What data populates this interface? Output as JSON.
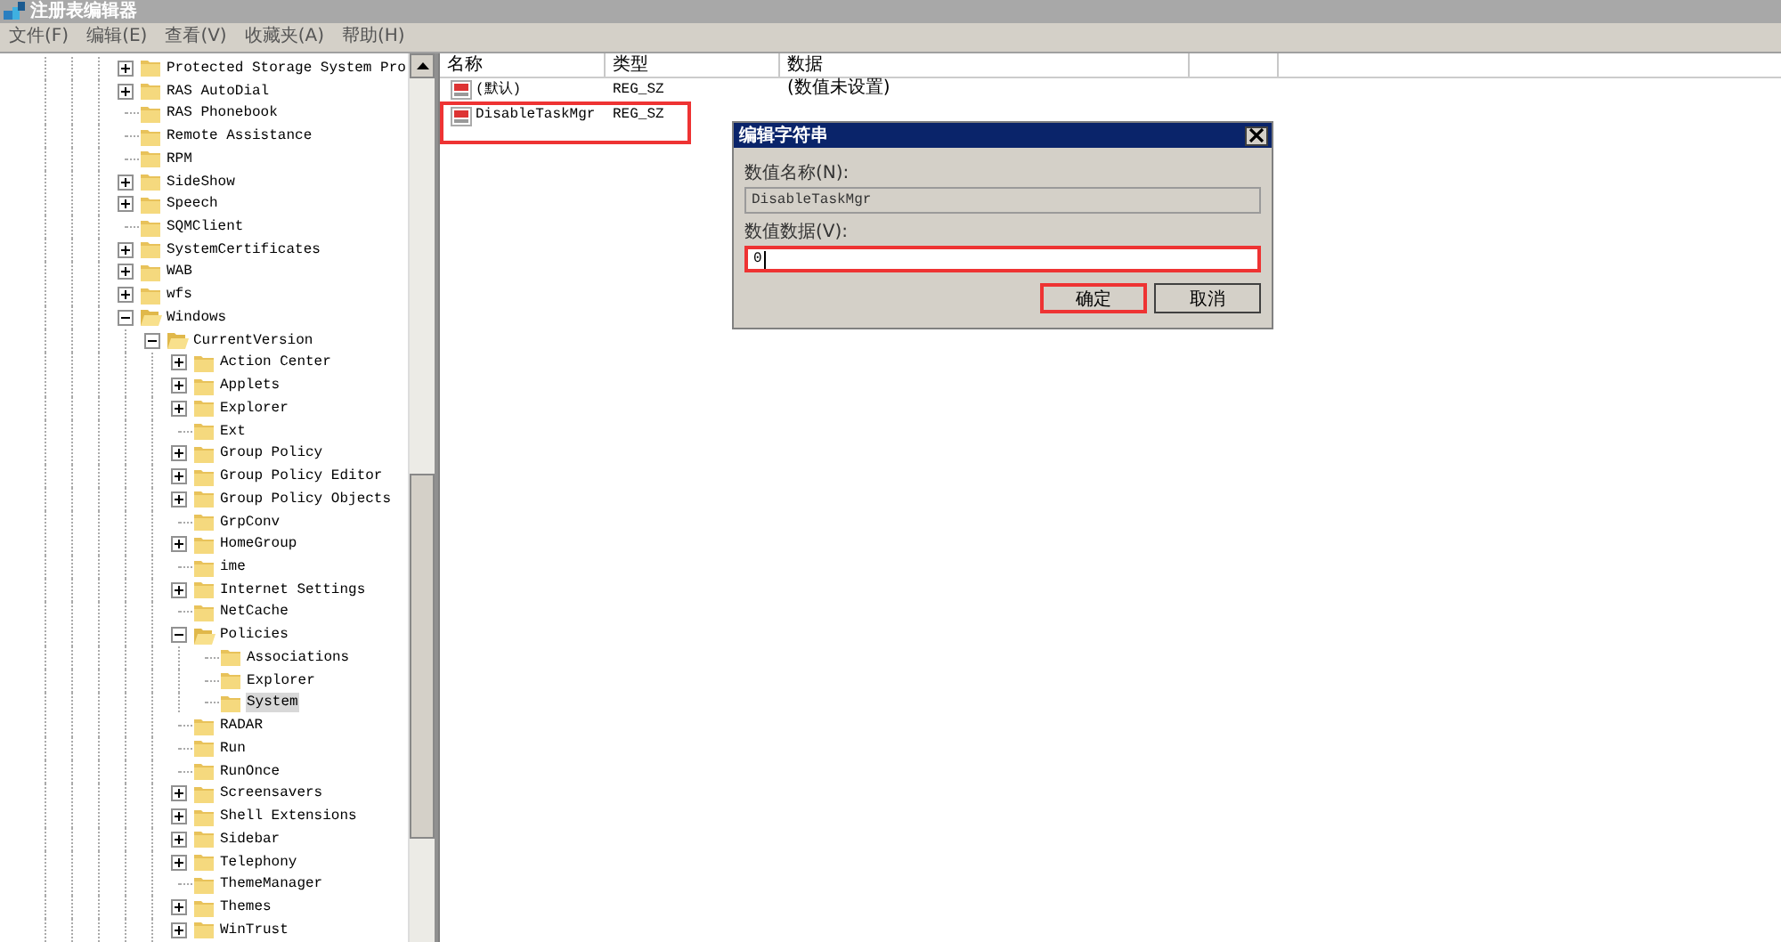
{
  "window": {
    "title": "注册表编辑器"
  },
  "menu": [
    "文件(F)",
    "编辑(E)",
    "查看(V)",
    "收藏夹(A)",
    "帮助(H)"
  ],
  "tree": [
    {
      "label": "Protected Storage System Pro",
      "expandable": true,
      "expanded": false,
      "selected": false
    },
    {
      "label": "RAS AutoDial",
      "expandable": true,
      "expanded": false,
      "selected": false
    },
    {
      "label": "RAS Phonebook",
      "expandable": false,
      "expanded": false,
      "selected": false
    },
    {
      "label": "Remote Assistance",
      "expandable": false,
      "expanded": false,
      "selected": false
    },
    {
      "label": "RPM",
      "expandable": false,
      "expanded": false,
      "selected": false
    },
    {
      "label": "SideShow",
      "expandable": true,
      "expanded": false,
      "selected": false
    },
    {
      "label": "Speech",
      "expandable": true,
      "expanded": false,
      "selected": false
    },
    {
      "label": "SQMClient",
      "expandable": false,
      "expanded": false,
      "selected": false
    },
    {
      "label": "SystemCertificates",
      "expandable": true,
      "expanded": false,
      "selected": false
    },
    {
      "label": "WAB",
      "expandable": true,
      "expanded": false,
      "selected": false
    },
    {
      "label": "wfs",
      "expandable": true,
      "expanded": false,
      "selected": false
    },
    {
      "label": "Windows",
      "expandable": true,
      "expanded": true,
      "selected": false,
      "children": [
        {
          "label": "CurrentVersion",
          "expandable": true,
          "expanded": true,
          "selected": false,
          "children": [
            {
              "label": "Action Center",
              "expandable": true,
              "expanded": false,
              "selected": false
            },
            {
              "label": "Applets",
              "expandable": true,
              "expanded": false,
              "selected": false
            },
            {
              "label": "Explorer",
              "expandable": true,
              "expanded": false,
              "selected": false
            },
            {
              "label": "Ext",
              "expandable": false,
              "expanded": false,
              "selected": false
            },
            {
              "label": "Group Policy",
              "expandable": true,
              "expanded": false,
              "selected": false
            },
            {
              "label": "Group Policy Editor",
              "expandable": true,
              "expanded": false,
              "selected": false
            },
            {
              "label": "Group Policy Objects",
              "expandable": true,
              "expanded": false,
              "selected": false
            },
            {
              "label": "GrpConv",
              "expandable": false,
              "expanded": false,
              "selected": false
            },
            {
              "label": "HomeGroup",
              "expandable": true,
              "expanded": false,
              "selected": false
            },
            {
              "label": "ime",
              "expandable": false,
              "expanded": false,
              "selected": false
            },
            {
              "label": "Internet Settings",
              "expandable": true,
              "expanded": false,
              "selected": false
            },
            {
              "label": "NetCache",
              "expandable": false,
              "expanded": false,
              "selected": false
            },
            {
              "label": "Policies",
              "expandable": true,
              "expanded": true,
              "selected": false,
              "children": [
                {
                  "label": "Associations",
                  "expandable": false,
                  "expanded": false,
                  "selected": false
                },
                {
                  "label": "Explorer",
                  "expandable": false,
                  "expanded": false,
                  "selected": false
                },
                {
                  "label": "System",
                  "expandable": false,
                  "expanded": false,
                  "selected": true
                }
              ]
            },
            {
              "label": "RADAR",
              "expandable": false,
              "expanded": false,
              "selected": false
            },
            {
              "label": "Run",
              "expandable": false,
              "expanded": false,
              "selected": false
            },
            {
              "label": "RunOnce",
              "expandable": false,
              "expanded": false,
              "selected": false
            },
            {
              "label": "Screensavers",
              "expandable": true,
              "expanded": false,
              "selected": false
            },
            {
              "label": "Shell Extensions",
              "expandable": true,
              "expanded": false,
              "selected": false
            },
            {
              "label": "Sidebar",
              "expandable": true,
              "expanded": false,
              "selected": false
            },
            {
              "label": "Telephony",
              "expandable": true,
              "expanded": false,
              "selected": false
            },
            {
              "label": "ThemeManager",
              "expandable": false,
              "expanded": false,
              "selected": false
            },
            {
              "label": "Themes",
              "expandable": true,
              "expanded": false,
              "selected": false
            },
            {
              "label": "WinTrust",
              "expandable": true,
              "expanded": false,
              "selected": false
            }
          ]
        }
      ]
    }
  ],
  "values": {
    "columns": [
      "名称",
      "类型",
      "数据"
    ],
    "rows": [
      {
        "name": "(默认)",
        "type": "REG_SZ",
        "data": "(数值未设置)",
        "highlighted": false
      },
      {
        "name": "DisableTaskMgr",
        "type": "REG_SZ",
        "data": "",
        "highlighted": true
      }
    ]
  },
  "dialog": {
    "title": "编辑字符串",
    "name_label": "数值名称(N):",
    "name_value": "DisableTaskMgr",
    "data_label": "数值数据(V):",
    "data_value": "0",
    "data_highlighted": true,
    "buttons": [
      {
        "label": "确定",
        "highlighted": true
      },
      {
        "label": "取消",
        "highlighted": false
      }
    ]
  }
}
